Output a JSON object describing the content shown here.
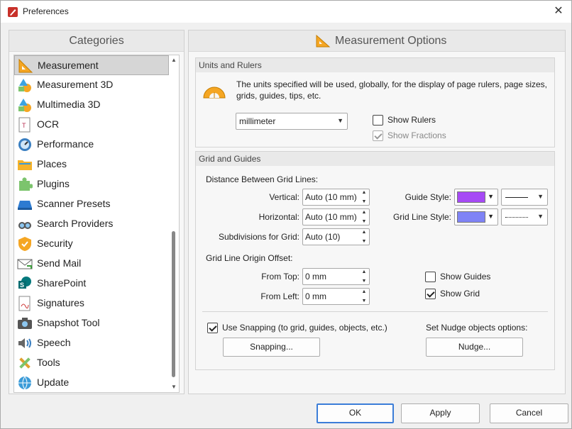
{
  "window": {
    "title": "Preferences",
    "close_label": "✕"
  },
  "categories": {
    "header": "Categories",
    "items": [
      {
        "label": "Measurement",
        "icon": "ruler-triangle-icon",
        "selected": true
      },
      {
        "label": "Measurement 3D",
        "icon": "shapes-3d-icon"
      },
      {
        "label": "Multimedia 3D",
        "icon": "shapes-3d-icon"
      },
      {
        "label": "OCR",
        "icon": "ocr-document-icon"
      },
      {
        "label": "Performance",
        "icon": "gauge-icon"
      },
      {
        "label": "Places",
        "icon": "folder-icon"
      },
      {
        "label": "Plugins",
        "icon": "puzzle-icon"
      },
      {
        "label": "Scanner Presets",
        "icon": "scanner-icon"
      },
      {
        "label": "Search Providers",
        "icon": "binoculars-icon"
      },
      {
        "label": "Security",
        "icon": "shield-icon"
      },
      {
        "label": "Send Mail",
        "icon": "envelope-icon"
      },
      {
        "label": "SharePoint",
        "icon": "sharepoint-icon"
      },
      {
        "label": "Signatures",
        "icon": "signature-document-icon"
      },
      {
        "label": "Snapshot Tool",
        "icon": "camera-icon"
      },
      {
        "label": "Speech",
        "icon": "speaker-icon"
      },
      {
        "label": "Tools",
        "icon": "tools-icon"
      },
      {
        "label": "Update",
        "icon": "globe-update-icon"
      }
    ]
  },
  "main": {
    "header": "Measurement Options",
    "units": {
      "title": "Units and Rulers",
      "description_line1": "The units specified will be used, globally, for the display of page rulers, page sizes,",
      "description_line2": "grids, guides, tips, etc.",
      "unit_value": "millimeter",
      "show_rulers": "Show Rulers",
      "show_fractions": "Show Fractions"
    },
    "grid": {
      "title": "Grid and Guides",
      "distance_label": "Distance Between Grid Lines:",
      "vertical_label": "Vertical:",
      "vertical_value": "Auto (10 mm)",
      "horizontal_label": "Horizontal:",
      "horizontal_value": "Auto (10 mm)",
      "subdivisions_label": "Subdivisions for Grid:",
      "subdivisions_value": "Auto (10)",
      "guide_style_label": "Guide Style:",
      "grid_line_style_label": "Grid Line Style:",
      "guide_color": "#a64af5",
      "grid_color": "#7f83f5",
      "origin_label": "Grid Line Origin Offset:",
      "from_top_label": "From Top:",
      "from_top_value": "0 mm",
      "from_left_label": "From Left:",
      "from_left_value": "0 mm",
      "show_guides": "Show Guides",
      "show_grid": "Show Grid",
      "use_snapping": "Use Snapping (to grid, guides, objects, etc.)",
      "snapping_button": "Snapping...",
      "nudge_label": "Set Nudge objects options:",
      "nudge_button": "Nudge..."
    }
  },
  "footer": {
    "ok": "OK",
    "apply": "Apply",
    "cancel": "Cancel"
  }
}
